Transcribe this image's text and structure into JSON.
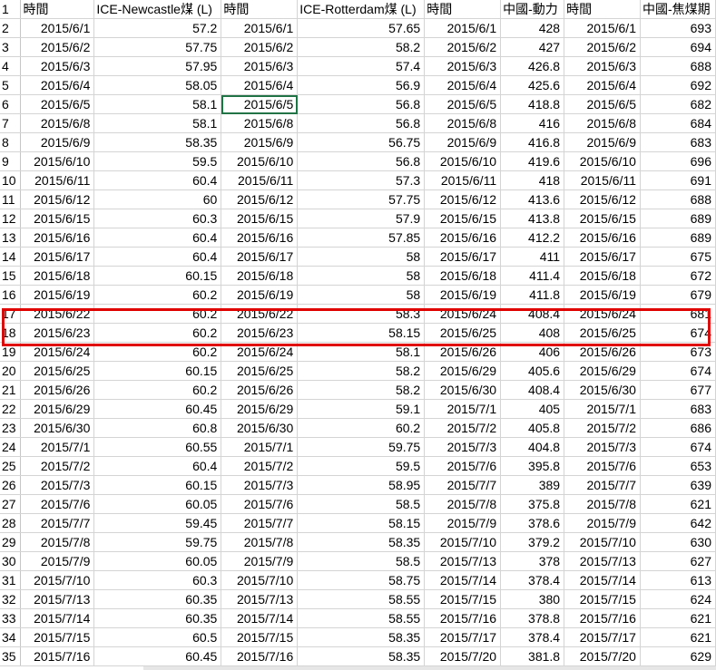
{
  "headers": [
    "時間",
    "ICE-Newcastle煤 (L)",
    "時間",
    "ICE-Rotterdam煤 (L)",
    "時間",
    "中國-動力",
    "時間",
    "中國-焦煤期"
  ],
  "rows": [
    [
      "2",
      "2015/6/1",
      "57.2",
      "2015/6/1",
      "57.65",
      "2015/6/1",
      "428",
      "2015/6/1",
      "693"
    ],
    [
      "3",
      "2015/6/2",
      "57.75",
      "2015/6/2",
      "58.2",
      "2015/6/2",
      "427",
      "2015/6/2",
      "694"
    ],
    [
      "4",
      "2015/6/3",
      "57.95",
      "2015/6/3",
      "57.4",
      "2015/6/3",
      "426.8",
      "2015/6/3",
      "688"
    ],
    [
      "5",
      "2015/6/4",
      "58.05",
      "2015/6/4",
      "56.9",
      "2015/6/4",
      "425.6",
      "2015/6/4",
      "692"
    ],
    [
      "6",
      "2015/6/5",
      "58.1",
      "2015/6/5",
      "56.8",
      "2015/6/5",
      "418.8",
      "2015/6/5",
      "682"
    ],
    [
      "7",
      "2015/6/8",
      "58.1",
      "2015/6/8",
      "56.8",
      "2015/6/8",
      "416",
      "2015/6/8",
      "684"
    ],
    [
      "8",
      "2015/6/9",
      "58.35",
      "2015/6/9",
      "56.75",
      "2015/6/9",
      "416.8",
      "2015/6/9",
      "683"
    ],
    [
      "9",
      "2015/6/10",
      "59.5",
      "2015/6/10",
      "56.8",
      "2015/6/10",
      "419.6",
      "2015/6/10",
      "696"
    ],
    [
      "10",
      "2015/6/11",
      "60.4",
      "2015/6/11",
      "57.3",
      "2015/6/11",
      "418",
      "2015/6/11",
      "691"
    ],
    [
      "11",
      "2015/6/12",
      "60",
      "2015/6/12",
      "57.75",
      "2015/6/12",
      "413.6",
      "2015/6/12",
      "688"
    ],
    [
      "12",
      "2015/6/15",
      "60.3",
      "2015/6/15",
      "57.9",
      "2015/6/15",
      "413.8",
      "2015/6/15",
      "689"
    ],
    [
      "13",
      "2015/6/16",
      "60.4",
      "2015/6/16",
      "57.85",
      "2015/6/16",
      "412.2",
      "2015/6/16",
      "689"
    ],
    [
      "14",
      "2015/6/17",
      "60.4",
      "2015/6/17",
      "58",
      "2015/6/17",
      "411",
      "2015/6/17",
      "675"
    ],
    [
      "15",
      "2015/6/18",
      "60.15",
      "2015/6/18",
      "58",
      "2015/6/18",
      "411.4",
      "2015/6/18",
      "672"
    ],
    [
      "16",
      "2015/6/19",
      "60.2",
      "2015/6/19",
      "58",
      "2015/6/19",
      "411.8",
      "2015/6/19",
      "679"
    ],
    [
      "17",
      "2015/6/22",
      "60.2",
      "2015/6/22",
      "58.3",
      "2015/6/24",
      "408.4",
      "2015/6/24",
      "681"
    ],
    [
      "18",
      "2015/6/23",
      "60.2",
      "2015/6/23",
      "58.15",
      "2015/6/25",
      "408",
      "2015/6/25",
      "674"
    ],
    [
      "19",
      "2015/6/24",
      "60.2",
      "2015/6/24",
      "58.1",
      "2015/6/26",
      "406",
      "2015/6/26",
      "673"
    ],
    [
      "20",
      "2015/6/25",
      "60.15",
      "2015/6/25",
      "58.2",
      "2015/6/29",
      "405.6",
      "2015/6/29",
      "674"
    ],
    [
      "21",
      "2015/6/26",
      "60.2",
      "2015/6/26",
      "58.2",
      "2015/6/30",
      "408.4",
      "2015/6/30",
      "677"
    ],
    [
      "22",
      "2015/6/29",
      "60.45",
      "2015/6/29",
      "59.1",
      "2015/7/1",
      "405",
      "2015/7/1",
      "683"
    ],
    [
      "23",
      "2015/6/30",
      "60.8",
      "2015/6/30",
      "60.2",
      "2015/7/2",
      "405.8",
      "2015/7/2",
      "686"
    ],
    [
      "24",
      "2015/7/1",
      "60.55",
      "2015/7/1",
      "59.75",
      "2015/7/3",
      "404.8",
      "2015/7/3",
      "674"
    ],
    [
      "25",
      "2015/7/2",
      "60.4",
      "2015/7/2",
      "59.5",
      "2015/7/6",
      "395.8",
      "2015/7/6",
      "653"
    ],
    [
      "26",
      "2015/7/3",
      "60.15",
      "2015/7/3",
      "58.95",
      "2015/7/7",
      "389",
      "2015/7/7",
      "639"
    ],
    [
      "27",
      "2015/7/6",
      "60.05",
      "2015/7/6",
      "58.5",
      "2015/7/8",
      "375.8",
      "2015/7/8",
      "621"
    ],
    [
      "28",
      "2015/7/7",
      "59.45",
      "2015/7/7",
      "58.15",
      "2015/7/9",
      "378.6",
      "2015/7/9",
      "642"
    ],
    [
      "29",
      "2015/7/8",
      "59.75",
      "2015/7/8",
      "58.35",
      "2015/7/10",
      "379.2",
      "2015/7/10",
      "630"
    ],
    [
      "30",
      "2015/7/9",
      "60.05",
      "2015/7/9",
      "58.5",
      "2015/7/13",
      "378",
      "2015/7/13",
      "627"
    ],
    [
      "31",
      "2015/7/10",
      "60.3",
      "2015/7/10",
      "58.75",
      "2015/7/14",
      "378.4",
      "2015/7/14",
      "613"
    ],
    [
      "32",
      "2015/7/13",
      "60.35",
      "2015/7/13",
      "58.55",
      "2015/7/15",
      "380",
      "2015/7/15",
      "624"
    ],
    [
      "33",
      "2015/7/14",
      "60.35",
      "2015/7/14",
      "58.55",
      "2015/7/16",
      "378.8",
      "2015/7/16",
      "621"
    ],
    [
      "34",
      "2015/7/15",
      "60.5",
      "2015/7/15",
      "58.35",
      "2015/7/17",
      "378.4",
      "2015/7/17",
      "621"
    ],
    [
      "35",
      "2015/7/16",
      "60.45",
      "2015/7/16",
      "58.35",
      "2015/7/20",
      "381.8",
      "2015/7/20",
      "629"
    ]
  ],
  "header_row_number": "1",
  "selected_row_number": "6",
  "selected_column_index": 3,
  "highlight_rows": [
    "17",
    "18"
  ],
  "colors": {
    "highlight_border": "#e00000",
    "selection_border": "#217346",
    "gridline": "#d4d4d4"
  }
}
